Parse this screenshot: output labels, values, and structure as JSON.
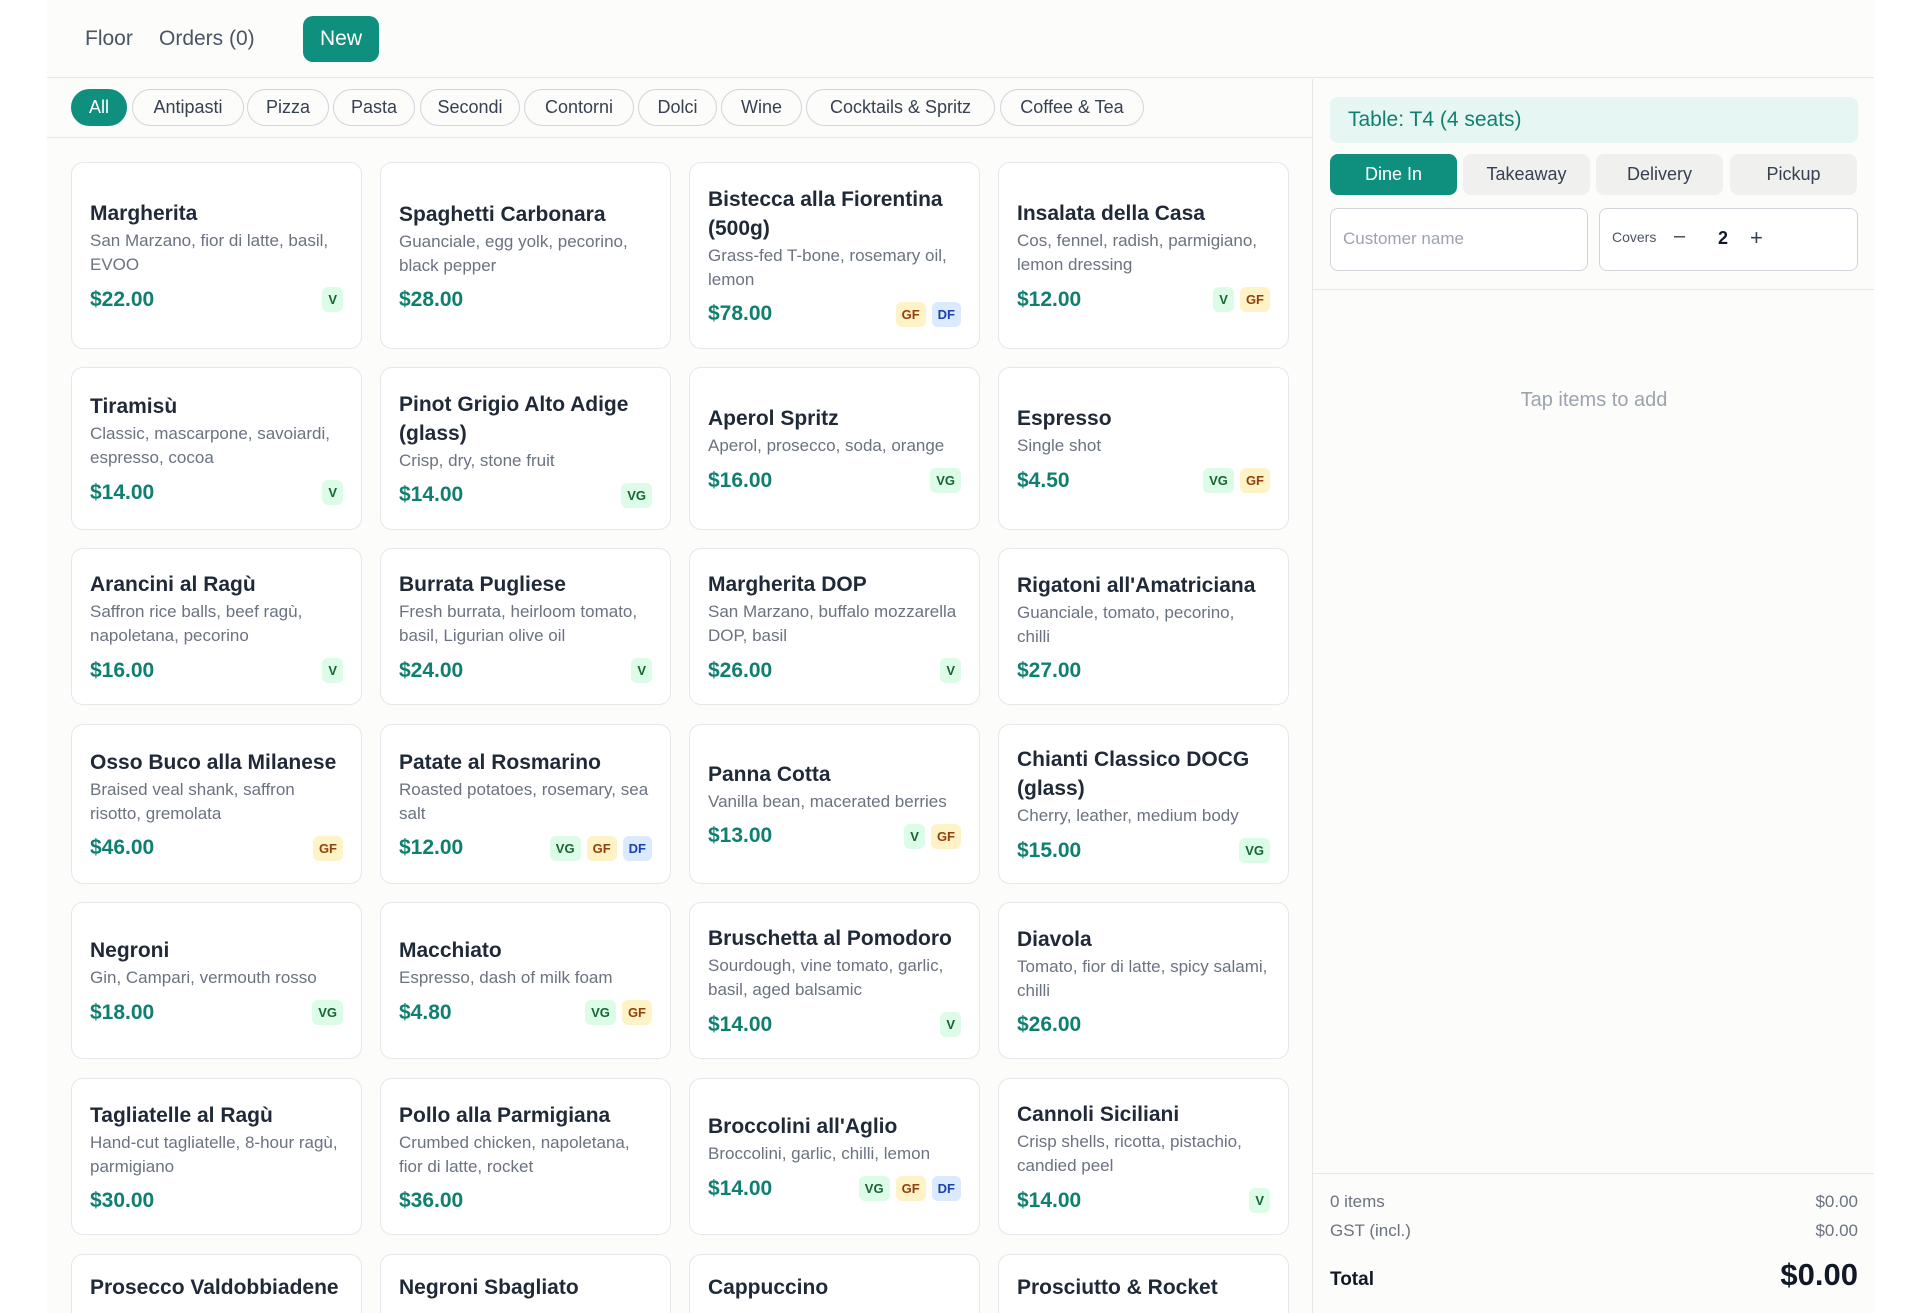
{
  "nav": {
    "tabs": [
      {
        "label": "Floor",
        "active": false
      },
      {
        "label": "Orders (0)",
        "active": false
      },
      {
        "label": "New",
        "active": true
      }
    ]
  },
  "categories": [
    {
      "label": "All",
      "active": true
    },
    {
      "label": "Antipasti"
    },
    {
      "label": "Pizza"
    },
    {
      "label": "Pasta"
    },
    {
      "label": "Secondi"
    },
    {
      "label": "Contorni"
    },
    {
      "label": "Dolci"
    },
    {
      "label": "Wine"
    },
    {
      "label": "Cocktails & Spritz"
    },
    {
      "label": "Coffee & Tea"
    }
  ],
  "menu_items": [
    {
      "name": "Margherita",
      "desc": "San Marzano, fior di latte, basil, EVOO",
      "price": "$22.00",
      "tags": [
        "V"
      ]
    },
    {
      "name": "Spaghetti Carbonara",
      "desc": "Guanciale, egg yolk, pecorino, black pepper",
      "price": "$28.00",
      "tags": []
    },
    {
      "name": "Bistecca alla Fiorentina (500g)",
      "desc": "Grass-fed T-bone, rosemary oil, lemon",
      "price": "$78.00",
      "tags": [
        "GF",
        "DF"
      ]
    },
    {
      "name": "Insalata della Casa",
      "desc": "Cos, fennel, radish, parmigiano, lemon dressing",
      "price": "$12.00",
      "tags": [
        "V",
        "GF"
      ]
    },
    {
      "name": "Tiramisù",
      "desc": "Classic, mascarpone, savoiardi, espresso, cocoa",
      "price": "$14.00",
      "tags": [
        "V"
      ]
    },
    {
      "name": "Pinot Grigio Alto Adige (glass)",
      "desc": "Crisp, dry, stone fruit",
      "price": "$14.00",
      "tags": [
        "VG"
      ]
    },
    {
      "name": "Aperol Spritz",
      "desc": "Aperol, prosecco, soda, orange",
      "price": "$16.00",
      "tags": [
        "VG"
      ]
    },
    {
      "name": "Espresso",
      "desc": "Single shot",
      "price": "$4.50",
      "tags": [
        "VG",
        "GF"
      ]
    },
    {
      "name": "Arancini al Ragù",
      "desc": "Saffron rice balls, beef ragù, napoletana, pecorino",
      "price": "$16.00",
      "tags": [
        "V"
      ]
    },
    {
      "name": "Burrata Pugliese",
      "desc": "Fresh burrata, heirloom tomato, basil, Ligurian olive oil",
      "price": "$24.00",
      "tags": [
        "V"
      ]
    },
    {
      "name": "Margherita DOP",
      "desc": "San Marzano, buffalo mozzarella DOP, basil",
      "price": "$26.00",
      "tags": [
        "V"
      ]
    },
    {
      "name": "Rigatoni all'Amatriciana",
      "desc": "Guanciale, tomato, pecorino, chilli",
      "price": "$27.00",
      "tags": []
    },
    {
      "name": "Osso Buco alla Milanese",
      "desc": "Braised veal shank, saffron risotto, gremolata",
      "price": "$46.00",
      "tags": [
        "GF"
      ]
    },
    {
      "name": "Patate al Rosmarino",
      "desc": "Roasted potatoes, rosemary, sea salt",
      "price": "$12.00",
      "tags": [
        "VG",
        "GF",
        "DF"
      ]
    },
    {
      "name": "Panna Cotta",
      "desc": "Vanilla bean, macerated berries",
      "price": "$13.00",
      "tags": [
        "V",
        "GF"
      ]
    },
    {
      "name": "Chianti Classico DOCG (glass)",
      "desc": "Cherry, leather, medium body",
      "price": "$15.00",
      "tags": [
        "VG"
      ]
    },
    {
      "name": "Negroni",
      "desc": "Gin, Campari, vermouth rosso",
      "price": "$18.00",
      "tags": [
        "VG"
      ]
    },
    {
      "name": "Macchiato",
      "desc": "Espresso, dash of milk foam",
      "price": "$4.80",
      "tags": [
        "VG",
        "GF"
      ]
    },
    {
      "name": "Bruschetta al Pomodoro",
      "desc": "Sourdough, vine tomato, garlic, basil, aged balsamic",
      "price": "$14.00",
      "tags": [
        "V"
      ]
    },
    {
      "name": "Diavola",
      "desc": "Tomato, fior di latte, spicy salami, chilli",
      "price": "$26.00",
      "tags": []
    },
    {
      "name": "Tagliatelle al Ragù",
      "desc": "Hand-cut tagliatelle, 8-hour ragù, parmigiano",
      "price": "$30.00",
      "tags": []
    },
    {
      "name": "Pollo alla Parmigiana",
      "desc": "Crumbed chicken, napoletana, fior di latte, rocket",
      "price": "$36.00",
      "tags": []
    },
    {
      "name": "Broccolini all'Aglio",
      "desc": "Broccolini, garlic, chilli, lemon",
      "price": "$14.00",
      "tags": [
        "VG",
        "GF",
        "DF"
      ]
    },
    {
      "name": "Cannoli Siciliani",
      "desc": "Crisp shells, ricotta, pistachio, candied peel",
      "price": "$14.00",
      "tags": [
        "V"
      ]
    },
    {
      "name": "Prosecco Valdobbiadene",
      "desc": "",
      "price": "",
      "tags": []
    },
    {
      "name": "Negroni Sbagliato",
      "desc": "",
      "price": "",
      "tags": []
    },
    {
      "name": "Cappuccino",
      "desc": "",
      "price": "",
      "tags": []
    },
    {
      "name": "Prosciutto & Rocket",
      "desc": "",
      "price": "",
      "tags": []
    }
  ],
  "order": {
    "table_label": "Table: T4 (4 seats)",
    "service_modes": [
      {
        "label": "Dine In",
        "active": true
      },
      {
        "label": "Takeaway"
      },
      {
        "label": "Delivery"
      },
      {
        "label": "Pickup"
      }
    ],
    "customer_placeholder": "Customer name",
    "covers_label": "Covers",
    "covers_minus": "–",
    "covers_value": "2",
    "covers_plus": "+",
    "empty_text": "Tap items to add",
    "items_label": "0 items",
    "items_value": "$0.00",
    "gst_label": "GST (incl.)",
    "gst_value": "$0.00",
    "total_label": "Total",
    "total_value": "$0.00"
  },
  "colors": {
    "accent": "#0f8f7e",
    "price": "#0f7f70"
  }
}
